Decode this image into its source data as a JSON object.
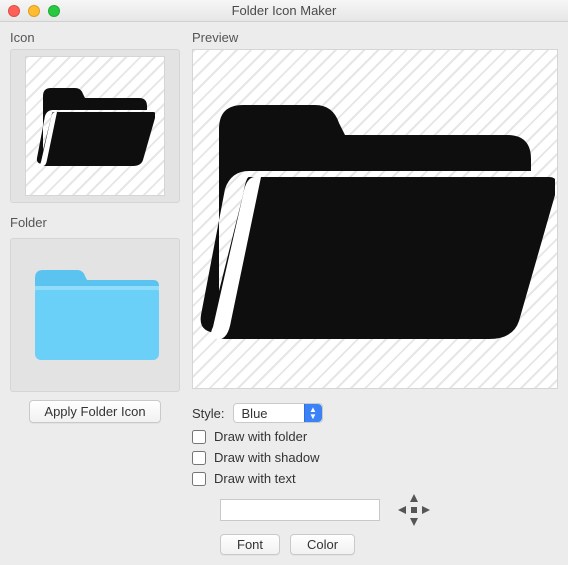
{
  "window": {
    "title": "Folder Icon Maker"
  },
  "labels": {
    "icon": "Icon",
    "folder": "Folder",
    "preview": "Preview",
    "style": "Style:"
  },
  "buttons": {
    "apply": "Apply Folder Icon",
    "font": "Font",
    "color": "Color"
  },
  "style_select": {
    "selected": "Blue"
  },
  "checkboxes": {
    "draw_with_folder": {
      "label": "Draw with folder",
      "checked": false
    },
    "draw_with_shadow": {
      "label": "Draw with shadow",
      "checked": false
    },
    "draw_with_text": {
      "label": "Draw with text",
      "checked": false
    }
  },
  "text_input": {
    "value": ""
  },
  "colors": {
    "folder_fill": "#6bd0f7",
    "folder_tab": "#5bc3ef",
    "icon_fill": "#0e0e0e"
  }
}
